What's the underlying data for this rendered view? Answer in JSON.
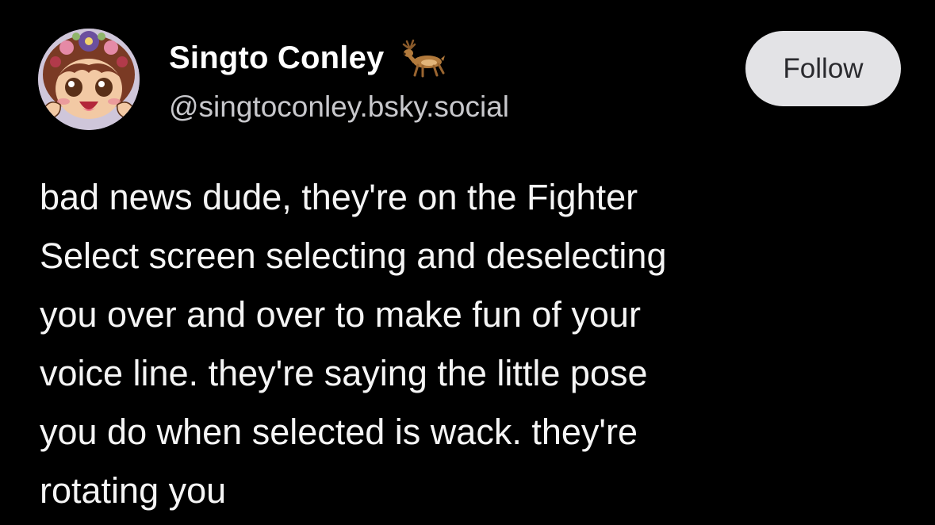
{
  "author": {
    "display_name": "Singto Conley",
    "name_emoji_icon": "deer-icon",
    "handle": "@singtoconley.bsky.social",
    "avatar": "cartoon-character-avatar"
  },
  "actions": {
    "follow_label": "Follow"
  },
  "post": {
    "lines": [
      "bad news dude, they're on the Fighter",
      "Select screen selecting and deselecting",
      "you over and over to make fun of your",
      "voice line. they're saying the little pose",
      "you do when selected is wack. they're",
      "rotating you"
    ]
  },
  "colors": {
    "background": "#000000",
    "text": "#f5f5f5",
    "handle": "#c8c8cc",
    "button_bg": "#e3e3e6",
    "button_text": "#2a2a2e"
  }
}
